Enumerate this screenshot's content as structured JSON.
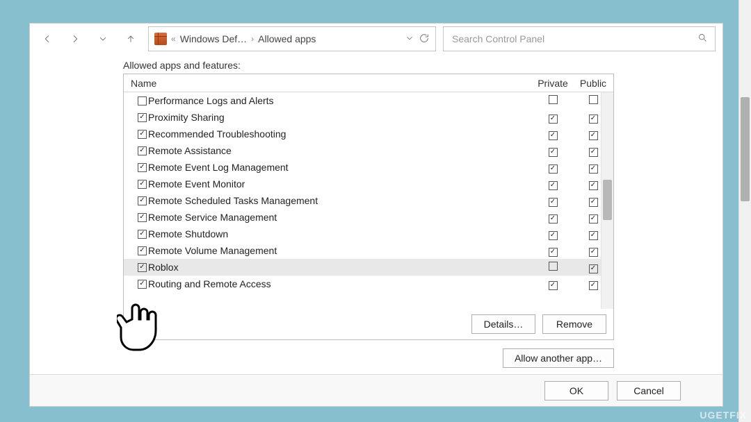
{
  "toolbar": {
    "breadcrumb_prefix": "«",
    "breadcrumb1": "Windows Def…",
    "breadcrumb2": "Allowed apps",
    "search_placeholder": "Search Control Panel"
  },
  "section_label": "Allowed apps and features:",
  "columns": {
    "name": "Name",
    "private": "Private",
    "public": "Public"
  },
  "rows": [
    {
      "label": "Performance Logs and Alerts",
      "enabled": false,
      "private": false,
      "public": false,
      "selected": false
    },
    {
      "label": "Proximity Sharing",
      "enabled": true,
      "private": true,
      "public": true,
      "selected": false
    },
    {
      "label": "Recommended Troubleshooting",
      "enabled": true,
      "private": true,
      "public": true,
      "selected": false
    },
    {
      "label": "Remote Assistance",
      "enabled": true,
      "private": true,
      "public": true,
      "selected": false
    },
    {
      "label": "Remote Event Log Management",
      "enabled": true,
      "private": true,
      "public": true,
      "selected": false
    },
    {
      "label": "Remote Event Monitor",
      "enabled": true,
      "private": true,
      "public": true,
      "selected": false
    },
    {
      "label": "Remote Scheduled Tasks Management",
      "enabled": true,
      "private": true,
      "public": true,
      "selected": false
    },
    {
      "label": "Remote Service Management",
      "enabled": true,
      "private": true,
      "public": true,
      "selected": false
    },
    {
      "label": "Remote Shutdown",
      "enabled": true,
      "private": true,
      "public": true,
      "selected": false
    },
    {
      "label": "Remote Volume Management",
      "enabled": true,
      "private": true,
      "public": true,
      "selected": false
    },
    {
      "label": "Roblox",
      "enabled": true,
      "private": false,
      "public": true,
      "selected": true
    },
    {
      "label": "Routing and Remote Access",
      "enabled": true,
      "private": true,
      "public": true,
      "selected": false
    }
  ],
  "buttons": {
    "details": "Details…",
    "remove": "Remove",
    "allow_another": "Allow another app…",
    "ok": "OK",
    "cancel": "Cancel"
  },
  "watermark": "UGETFIX"
}
